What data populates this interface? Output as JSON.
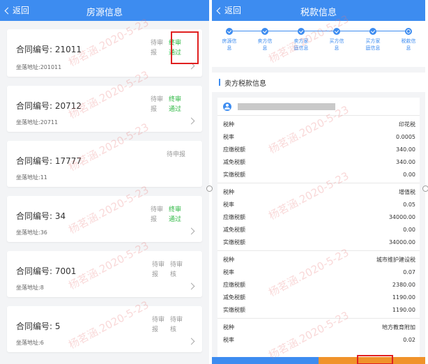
{
  "left": {
    "back_label": "返回",
    "title": "房源信息",
    "cards": [
      {
        "contract": "合同编号: 21011",
        "status_pending": "待审报",
        "status_ok": "终审通过",
        "address": "坐落地址:201011"
      },
      {
        "contract": "合同编号: 20712",
        "status_pending": "待审报",
        "status_ok": "终审通过",
        "address": "坐落地址:20711"
      },
      {
        "contract": "合同编号: 17777",
        "status_single": "待申报",
        "address": "坐落地址:11"
      },
      {
        "contract": "合同编号: 34",
        "status_pending": "待审报",
        "status_ok": "终审通过",
        "address": "坐落地址:36"
      },
      {
        "contract": "合同编号: 7001",
        "status_pending": "待审报",
        "status_wait": "待审核",
        "address": "坐落地址:8"
      },
      {
        "contract": "合同编号: 5",
        "status_pending": "待审报",
        "status_wait": "待审核",
        "address": "坐落地址:6"
      }
    ]
  },
  "right": {
    "back_label": "返回",
    "title": "税款信息",
    "steps": [
      "房源信息",
      "卖方信息",
      "卖方家庭信息",
      "买方信息",
      "买方家庭信息",
      "税款信息"
    ],
    "section_title": "卖方税款信息",
    "tax_groups": [
      {
        "rows": [
          [
            "税种",
            "印花税"
          ],
          [
            "税率",
            "0.0005"
          ],
          [
            "应缴税额",
            "340.00"
          ],
          [
            "减免税额",
            "340.00"
          ],
          [
            "实缴税额",
            "0.00"
          ]
        ]
      },
      {
        "rows": [
          [
            "税种",
            "增值税"
          ],
          [
            "税率",
            "0.05"
          ],
          [
            "应缴税额",
            "34000.00"
          ],
          [
            "减免税额",
            "0.00"
          ],
          [
            "实缴税额",
            "34000.00"
          ]
        ]
      },
      {
        "rows": [
          [
            "税种",
            "城市维护建设税"
          ],
          [
            "税率",
            "0.07"
          ],
          [
            "应缴税额",
            "2380.00"
          ],
          [
            "减免税额",
            "1190.00"
          ],
          [
            "实缴税额",
            "1190.00"
          ]
        ]
      },
      {
        "rows": [
          [
            "税种",
            "地方教育附加"
          ],
          [
            "税率",
            "0.02"
          ]
        ]
      }
    ]
  },
  "watermark_text": "杨茗涵.2020-5-23",
  "colors": {
    "accent": "#3d8cf0",
    "ok": "#2fb844",
    "highlight": "#e02020",
    "orange": "#f0932a"
  }
}
